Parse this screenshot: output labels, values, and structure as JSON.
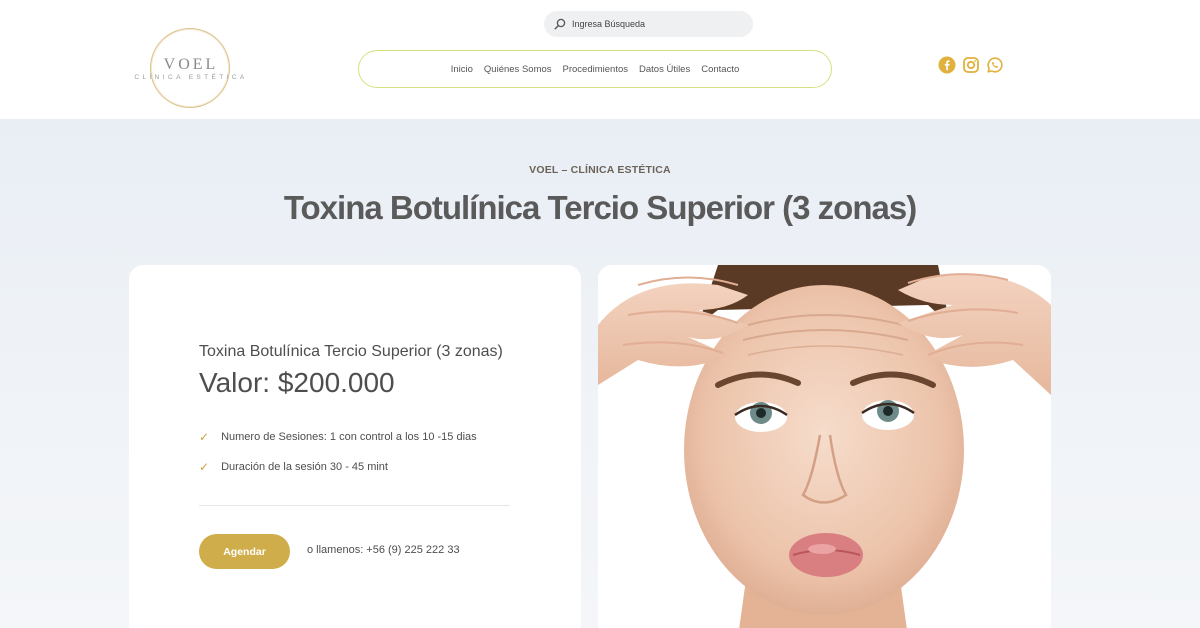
{
  "brand": {
    "name": "VOEL",
    "tagline": "CLÍNICA ESTÉTICA"
  },
  "search": {
    "placeholder": "Ingresa Búsqueda"
  },
  "nav": {
    "items": [
      "Inicio",
      "Quiénes Somos",
      "Procedimientos",
      "Datos Útiles",
      "Contacto"
    ]
  },
  "social": {
    "icons": [
      "facebook-icon",
      "instagram-icon",
      "whatsapp-icon"
    ],
    "color": "#e0b13c"
  },
  "hero": {
    "eyebrow": "VOEL – CLÍNICA ESTÉTICA",
    "title": "Toxina Botulínica Tercio Superior (3 zonas)"
  },
  "card": {
    "name": "Toxina Botulínica Tercio Superior (3 zonas)",
    "price": "Valor: $200.000",
    "features": [
      "Numero de Sesiones: 1 con control a los 10 -15 dias",
      "Duración de la sesión 30 - 45 mint"
    ],
    "button_label": "Agendar",
    "call_text": "o llamenos: +56 (9) 225 222 33"
  },
  "colors": {
    "accent": "#d0ad4b",
    "nav_border": "#d7e081",
    "hero_bg": "#eaeff5"
  }
}
